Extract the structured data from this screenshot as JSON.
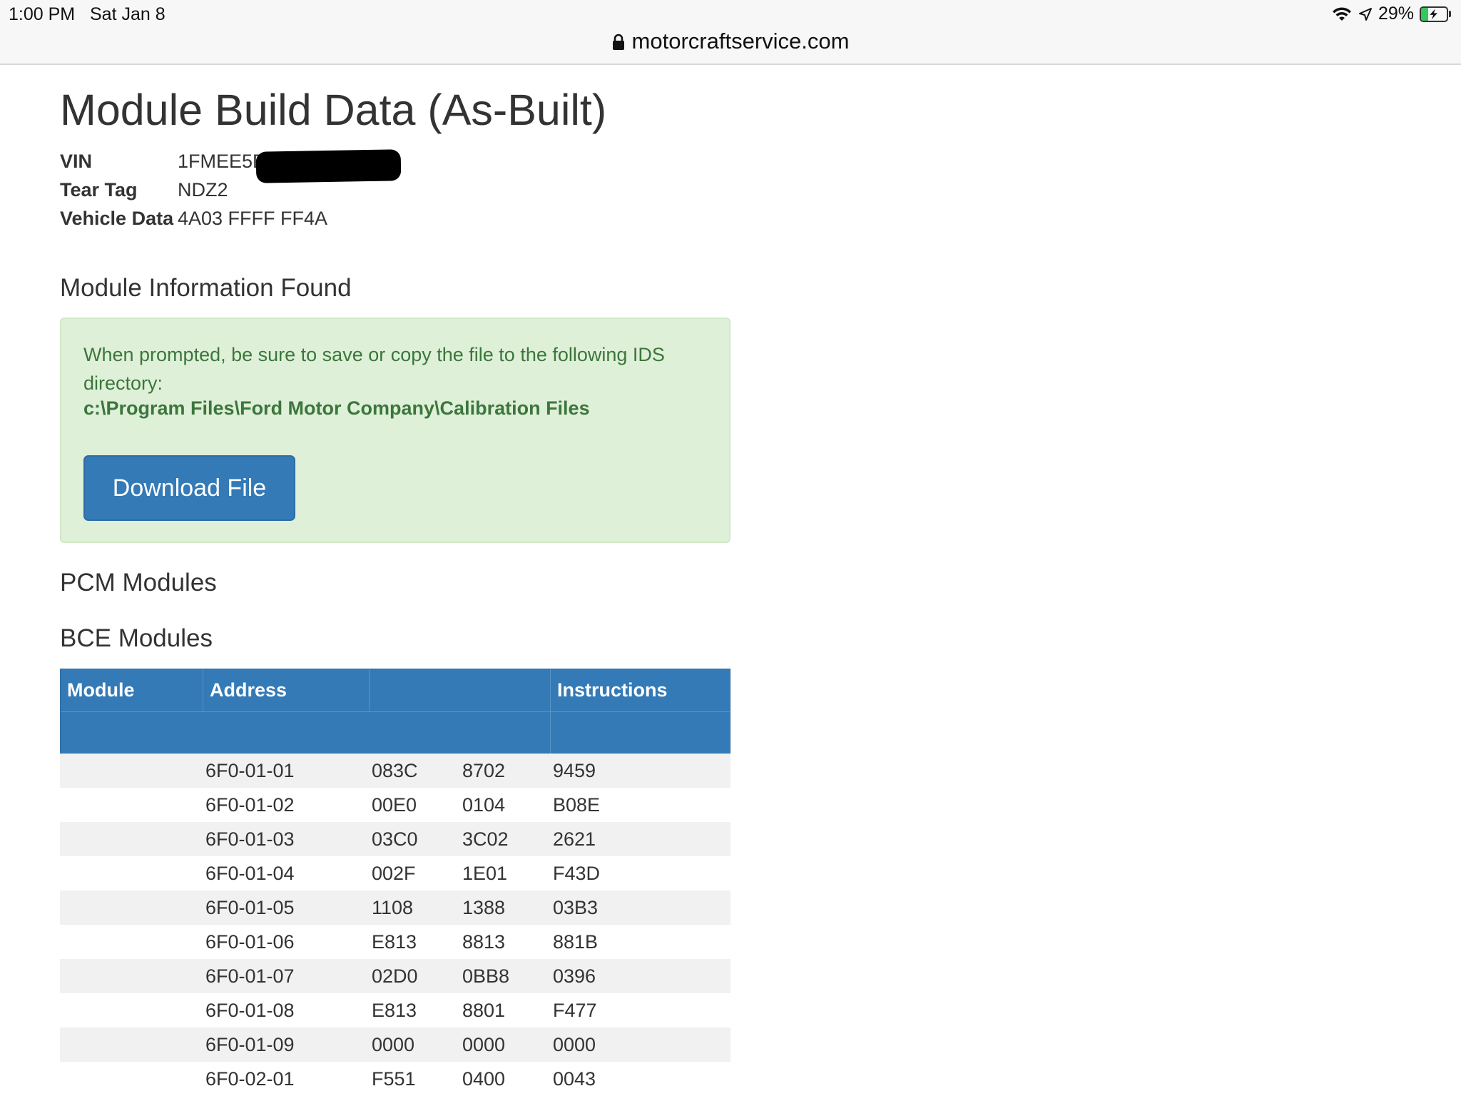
{
  "status_bar": {
    "time": "1:00 PM",
    "date": "Sat Jan 8",
    "battery_percent": "29%",
    "battery_level": 0.29,
    "url": "motorcraftservice.com"
  },
  "page": {
    "title": "Module Build Data (As-Built)",
    "vin_label": "VIN",
    "vin_value": "1FMEE5D",
    "tear_tag_label": "Tear Tag",
    "tear_tag_value": "NDZ2",
    "vehicle_data_label": "Vehicle Data",
    "vehicle_data_value": "4A03 FFFF FF4A",
    "module_info_heading": "Module Information Found",
    "alert_message": "When prompted, be sure to save or copy the file to the following IDS directory:",
    "alert_path": "c:\\Program Files\\Ford Motor Company\\Calibration Files",
    "download_button": "Download File",
    "pcm_heading": "PCM Modules",
    "bce_heading": "BCE Modules"
  },
  "table": {
    "headers": {
      "module": "Module",
      "address": "Address",
      "instructions": "Instructions"
    },
    "rows": [
      [
        "",
        "6F0-01-01",
        "083C",
        "8702",
        "9459"
      ],
      [
        "",
        "6F0-01-02",
        "00E0",
        "0104",
        "B08E"
      ],
      [
        "",
        "6F0-01-03",
        "03C0",
        "3C02",
        "2621"
      ],
      [
        "",
        "6F0-01-04",
        "002F",
        "1E01",
        "F43D"
      ],
      [
        "",
        "6F0-01-05",
        "1108",
        "1388",
        "03B3"
      ],
      [
        "",
        "6F0-01-06",
        "E813",
        "8813",
        "881B"
      ],
      [
        "",
        "6F0-01-07",
        "02D0",
        "0BB8",
        "0396"
      ],
      [
        "",
        "6F0-01-08",
        "E813",
        "8801",
        "F477"
      ],
      [
        "",
        "6F0-01-09",
        "0000",
        "0000",
        "0000"
      ],
      [
        "",
        "6F0-02-01",
        "F551",
        "0400",
        "0043"
      ]
    ]
  },
  "colors": {
    "primary": "#337ab7",
    "alert_bg": "#dff0d8",
    "alert_text": "#3c763d",
    "stripe": "#f1f1f1"
  }
}
